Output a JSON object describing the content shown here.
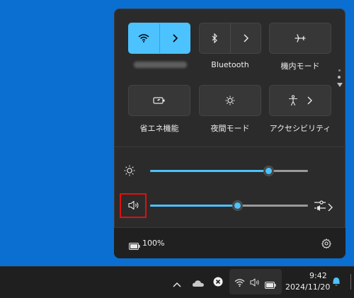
{
  "quick_settings": {
    "tiles": [
      {
        "id": "wifi",
        "label": "",
        "active": true,
        "icon": "wifi-icon",
        "split": true,
        "secondary_icon": "chevron-right-icon"
      },
      {
        "id": "bluetooth",
        "label": "Bluetooth",
        "active": false,
        "icon": "bluetooth-icon",
        "split": true,
        "secondary_icon": "chevron-right-icon"
      },
      {
        "id": "airplane",
        "label": "機内モード",
        "active": false,
        "icon": "airplane-icon",
        "split": false
      },
      {
        "id": "battery_saver",
        "label": "省エネ機能",
        "active": false,
        "icon": "battery-saver-icon",
        "split": false
      },
      {
        "id": "night_light",
        "label": "夜間モード",
        "active": false,
        "icon": "night-light-icon",
        "split": false
      },
      {
        "id": "accessibility",
        "label": "アクセシビリティ",
        "active": false,
        "icon": "accessibility-icon",
        "split": false,
        "secondary_icon": "chevron-right-icon"
      }
    ],
    "brightness": {
      "icon": "brightness-icon",
      "value_percent": 75
    },
    "volume": {
      "icon": "volume-icon",
      "value_percent": 55,
      "extra_icons": [
        "audio-output-icon",
        "chevron-right-icon"
      ]
    },
    "footer": {
      "battery_text": "100%",
      "battery_icon": "battery-icon",
      "settings_icon": "gear-icon"
    }
  },
  "taskbar": {
    "tray_icons": [
      "chevron-up-icon",
      "cloud-icon",
      "close-circle-icon"
    ],
    "status_icons": [
      "wifi-icon",
      "volume-icon",
      "battery-icon"
    ],
    "time": "9:42",
    "date": "2024/11/20",
    "notification_icon": "bell-icon"
  },
  "colors": {
    "accent": "#4cc2ff",
    "desktop": "#0a6fd0",
    "highlight": "#e01010"
  }
}
